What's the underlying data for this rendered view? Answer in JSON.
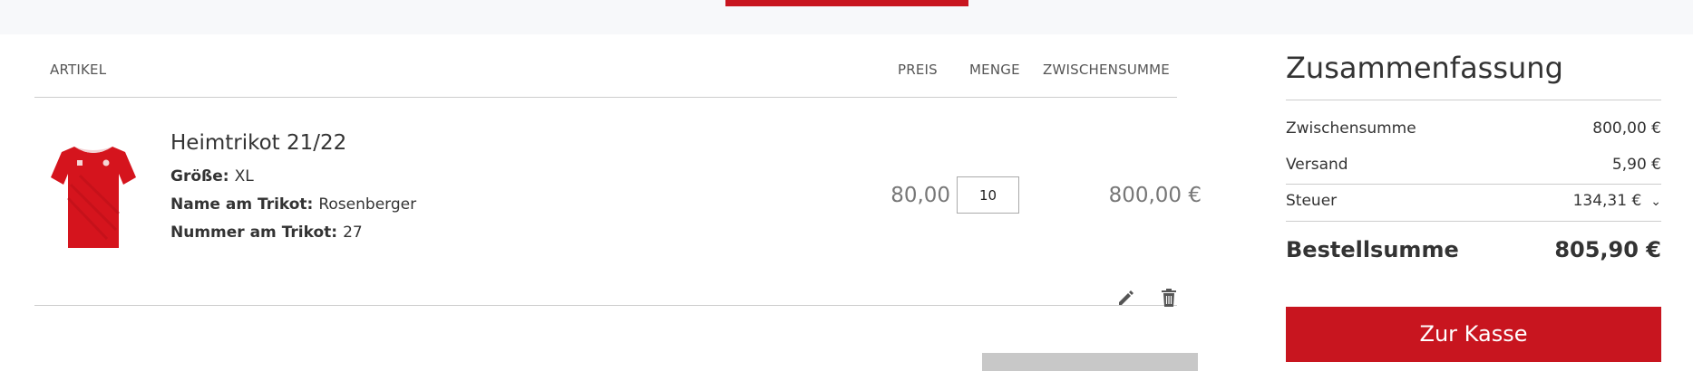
{
  "cart": {
    "headers": {
      "item": "ARTIKEL",
      "price": "PREIS",
      "quantity": "MENGE",
      "subtotal": "ZWISCHENSUMME"
    },
    "items": [
      {
        "title": "Heimtrikot 21/22",
        "image_icon": "red-jersey-icon",
        "options": [
          {
            "label": "Größe:",
            "value": "XL"
          },
          {
            "label": "Name am Trikot:",
            "value": "Rosenberger"
          },
          {
            "label": "Nummer am Trikot:",
            "value": "27"
          }
        ],
        "price": "80,00 €",
        "quantity": "10",
        "subtotal": "800,00 €"
      }
    ]
  },
  "summary": {
    "title": "Zusammenfassung",
    "rows": [
      {
        "label": "Zwischensumme",
        "value": "800,00 €"
      },
      {
        "label": "Versand",
        "value": "5,90 €"
      },
      {
        "label": "Steuer",
        "value": "134,31 €"
      }
    ],
    "total_label": "Bestellsumme",
    "total_value": "805,90 €",
    "checkout_label": "Zur Kasse"
  },
  "colors": {
    "accent": "#c8151f",
    "top_band": "#f7f8fa",
    "secondary_button": "#c8c8c8"
  }
}
